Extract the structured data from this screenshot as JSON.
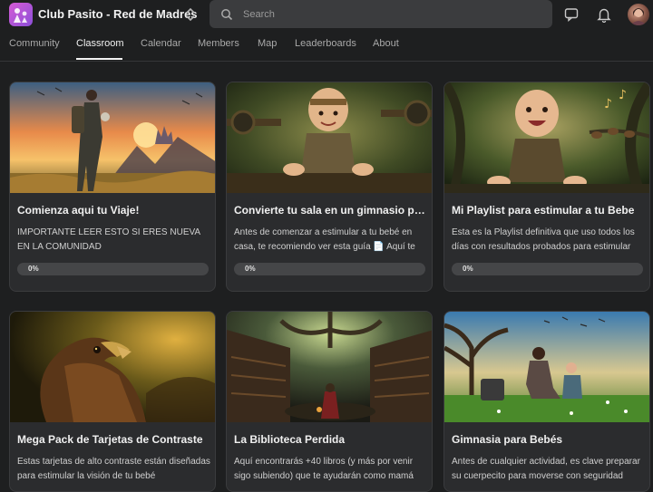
{
  "group": {
    "name": "Club Pasito - Red de Madres"
  },
  "search": {
    "placeholder": "Search"
  },
  "nav": {
    "tabs": [
      {
        "label": "Community"
      },
      {
        "label": "Classroom",
        "active": true
      },
      {
        "label": "Calendar"
      },
      {
        "label": "Members"
      },
      {
        "label": "Map"
      },
      {
        "label": "Leaderboards"
      },
      {
        "label": "About"
      }
    ]
  },
  "icons": {
    "chat": "chat-bubble-icon",
    "notifications": "bell-icon",
    "switcher": "chevron-updown-icon",
    "search": "search-icon"
  },
  "colors": {
    "background": "#1e1f20",
    "card": "#2b2c2e",
    "progress_track": "#454648"
  },
  "courses": [
    {
      "title": "Comienza aqui tu Viaje!",
      "description": "IMPORTANTE LEER ESTO SI ERES NUEVA EN LA COMUNIDAD",
      "progress_label": "0%",
      "progress": 0
    },
    {
      "title": "Convierte tu sala en un gimnasio para bebés",
      "description": "Antes de comenzar a estimular a tu bebé en casa, te recomiendo ver esta guía 📄 Aquí te enseño",
      "progress_label": "0%",
      "progress": 0
    },
    {
      "title": "Mi Playlist para estimular a tu Bebe",
      "description": "Esta es la Playlist definitiva que uso todos los días con resultados probados para estimular",
      "progress_label": "0%",
      "progress": 0
    },
    {
      "title": "Mega Pack de Tarjetas de Contraste",
      "description": "Estas tarjetas de alto contraste están diseñadas para estimular la visión de tu bebé",
      "progress_label": "0%",
      "progress": 0
    },
    {
      "title": "La Biblioteca Perdida",
      "description": "Aquí encontrarás +40 libros (y más por venir sigo subiendo) que te ayudarán como mamá",
      "progress_label": "0%",
      "progress": 0
    },
    {
      "title": "Gimnasia para Bebés",
      "description": "Antes de cualquier actividad, es clave preparar su cuerpecito para moverse con seguridad",
      "progress_label": "0%",
      "progress": 0
    }
  ]
}
